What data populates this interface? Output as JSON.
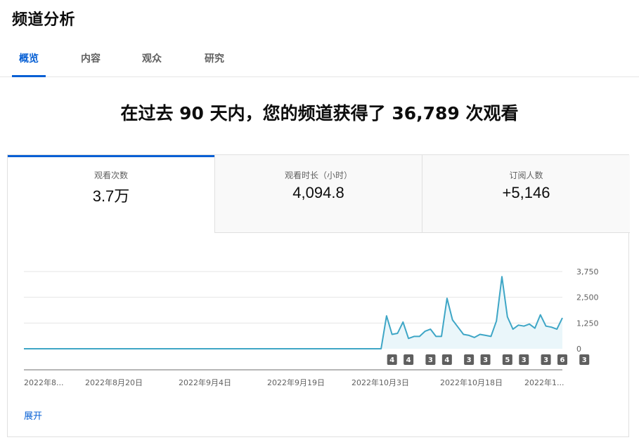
{
  "page": {
    "title": "频道分析"
  },
  "tabs": [
    {
      "label": "概览",
      "active": true
    },
    {
      "label": "内容",
      "active": false
    },
    {
      "label": "观众",
      "active": false
    },
    {
      "label": "研究",
      "active": false
    }
  ],
  "headline": "在过去 90 天内，您的频道获得了 36,789 次观看",
  "metrics": [
    {
      "label": "观看次数",
      "value": "3.7万",
      "active": true
    },
    {
      "label": "观看时长（小时）",
      "value": "4,094.8",
      "active": false
    },
    {
      "label": "订阅人数",
      "value": "+5,146",
      "active": false
    }
  ],
  "colors": {
    "accent": "#065fd4",
    "line": "#3ea6c6",
    "fill": "#eaf6fa",
    "marker": "#5f5f5f"
  },
  "chart_data": {
    "type": "area",
    "ylim": [
      0,
      3750
    ],
    "yticks": [
      "3,750",
      "2,500",
      "1,250",
      "0"
    ],
    "xticks": [
      "2022年8...",
      "2022年8月20日",
      "2022年9月4日",
      "2022年9月19日",
      "2022年10月3日",
      "2022年10月18日",
      "2022年1..."
    ],
    "values": [
      0,
      0,
      0,
      0,
      0,
      0,
      0,
      0,
      0,
      0,
      0,
      0,
      0,
      0,
      0,
      0,
      0,
      0,
      0,
      0,
      0,
      0,
      0,
      0,
      0,
      0,
      0,
      0,
      0,
      0,
      0,
      0,
      0,
      0,
      0,
      0,
      0,
      0,
      0,
      0,
      0,
      0,
      0,
      0,
      0,
      0,
      0,
      0,
      0,
      0,
      0,
      0,
      0,
      0,
      0,
      0,
      0,
      0,
      0,
      0,
      0,
      0,
      0,
      0,
      0,
      0,
      1600,
      700,
      750,
      1300,
      500,
      600,
      600,
      850,
      950,
      600,
      600,
      2450,
      1400,
      1050,
      700,
      650,
      550,
      700,
      650,
      600,
      1350,
      3500,
      1550,
      950,
      1150,
      1100,
      1200,
      1000,
      1650,
      1100,
      1050,
      950,
      1500
    ],
    "markers": [
      {
        "label": "4",
        "index": 67
      },
      {
        "label": "4",
        "index": 70
      },
      {
        "label": "3",
        "index": 74
      },
      {
        "label": "4",
        "index": 77
      },
      {
        "label": "3",
        "index": 81
      },
      {
        "label": "3",
        "index": 84
      },
      {
        "label": "5",
        "index": 88
      },
      {
        "label": "3",
        "index": 91
      },
      {
        "label": "3",
        "index": 95
      },
      {
        "label": "6",
        "index": 98
      },
      {
        "label": "3",
        "index": 102
      }
    ]
  },
  "footer": {
    "expand_label": "展开"
  }
}
